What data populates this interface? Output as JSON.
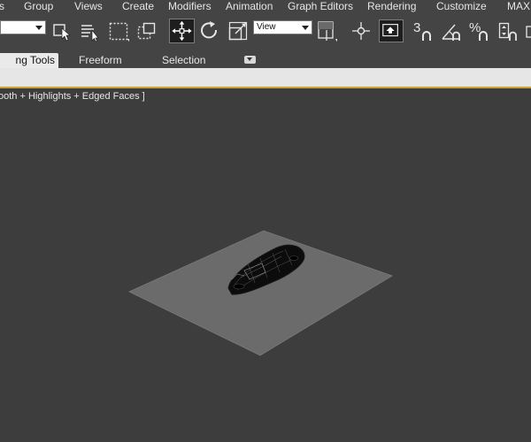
{
  "menubar": {
    "items": [
      "s",
      "Group",
      "Views",
      "Create",
      "Modifiers",
      "Animation",
      "Graph Editors",
      "Rendering",
      "Customize",
      "MAX"
    ]
  },
  "toolbar": {
    "view_dropdown": "View",
    "snap_label": "3",
    "percent_label": "%"
  },
  "ribbon": {
    "tabs": [
      "ng Tools",
      "Freeform",
      "Selection"
    ]
  },
  "viewport": {
    "label": "ooth + Highlights + Edged Faces ]",
    "background": "#3d3d3d",
    "plane_color": "#6b6b6b"
  }
}
